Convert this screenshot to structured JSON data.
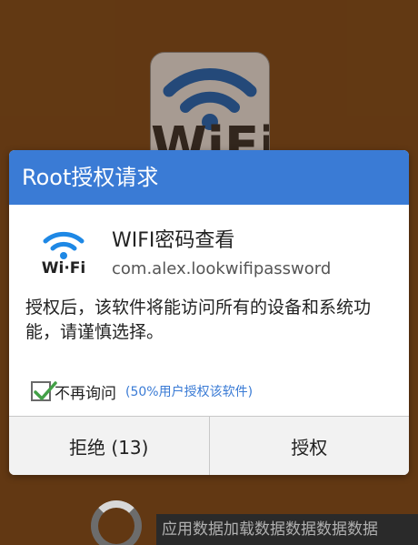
{
  "background": {
    "app_icon_text": "WiFi",
    "loading_text": "应用数据加载数据数据数据数据"
  },
  "dialog": {
    "title": "Root授权请求",
    "app": {
      "icon": "wifi-icon",
      "icon_text": "Wi·Fi",
      "name": "WIFI密码查看",
      "package": "com.alex.lookwifipassword"
    },
    "message": "授权后，该软件将能访问所有的设备和系统功能，请谨慎选择。",
    "remember": {
      "checked": true,
      "label": "不再询问",
      "hint": "(50%用户授权该软件)"
    },
    "buttons": {
      "deny": "拒绝 (13)",
      "grant": "授权"
    }
  },
  "colors": {
    "header": "#3a7bd5",
    "wifi_icon": "#1e88e5",
    "background": "#7a4a1c"
  }
}
